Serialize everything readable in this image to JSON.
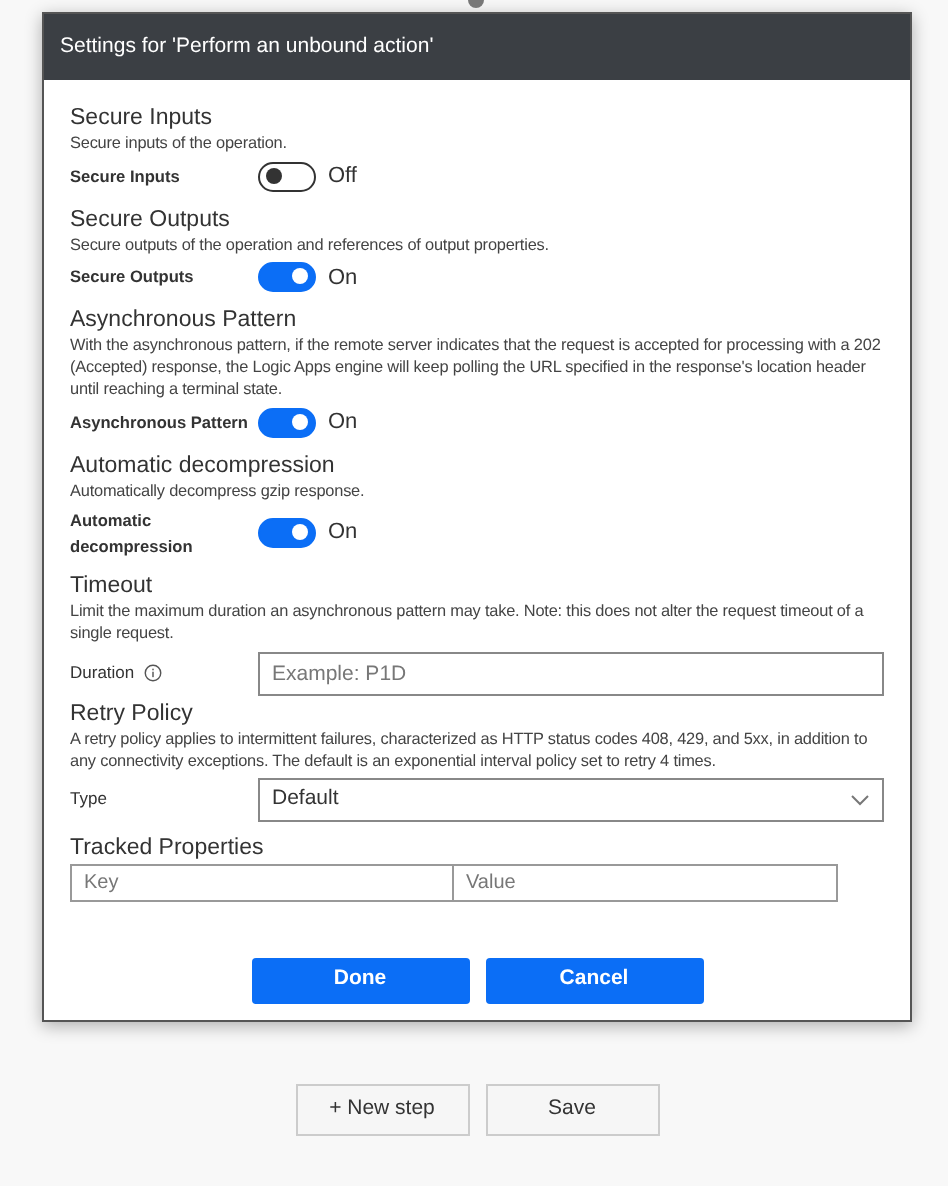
{
  "dialog": {
    "title": "Settings for 'Perform an unbound action'",
    "sections": [
      {
        "kind": "toggle",
        "heading": "Secure Inputs",
        "description": "Secure inputs of the operation.",
        "label": "Secure Inputs",
        "on": false,
        "state_text": "Off"
      },
      {
        "kind": "toggle",
        "heading": "Secure Outputs",
        "description": "Secure outputs of the operation and references of output properties.",
        "label": "Secure Outputs",
        "on": true,
        "state_text": "On"
      },
      {
        "kind": "toggle",
        "heading": "Asynchronous Pattern",
        "description": "With the asynchronous pattern, if the remote server indicates that the request is accepted for processing with a 202 (Accepted) response, the Logic Apps engine will keep polling the URL specified in the response's location header until reaching a terminal state.",
        "label": "Asynchronous Pattern",
        "on": true,
        "state_text": "On"
      },
      {
        "kind": "toggle",
        "heading": "Automatic decompression",
        "description": "Automatically decompress gzip response.",
        "label": "Automatic decompression",
        "on": true,
        "state_text": "On"
      },
      {
        "kind": "input",
        "heading": "Timeout",
        "description": "Limit the maximum duration an asynchronous pattern may take. Note: this does not alter the request timeout of a single request.",
        "label": "Duration",
        "placeholder": "Example: P1D"
      },
      {
        "kind": "select",
        "heading": "Retry Policy",
        "description": "A retry policy applies to intermittent failures, characterized as HTTP status codes 408, 429, and 5xx, in addition to any connectivity exceptions. The default is an exponential interval policy set to retry 4 times.",
        "label": "Type",
        "value": "Default"
      },
      {
        "kind": "pairs",
        "heading": "Tracked Properties",
        "key_placeholder": "Key",
        "value_placeholder": "Value"
      }
    ],
    "buttons": [
      "Done",
      "Cancel"
    ]
  },
  "footer_buttons": [
    "+ New step",
    "Save"
  ]
}
